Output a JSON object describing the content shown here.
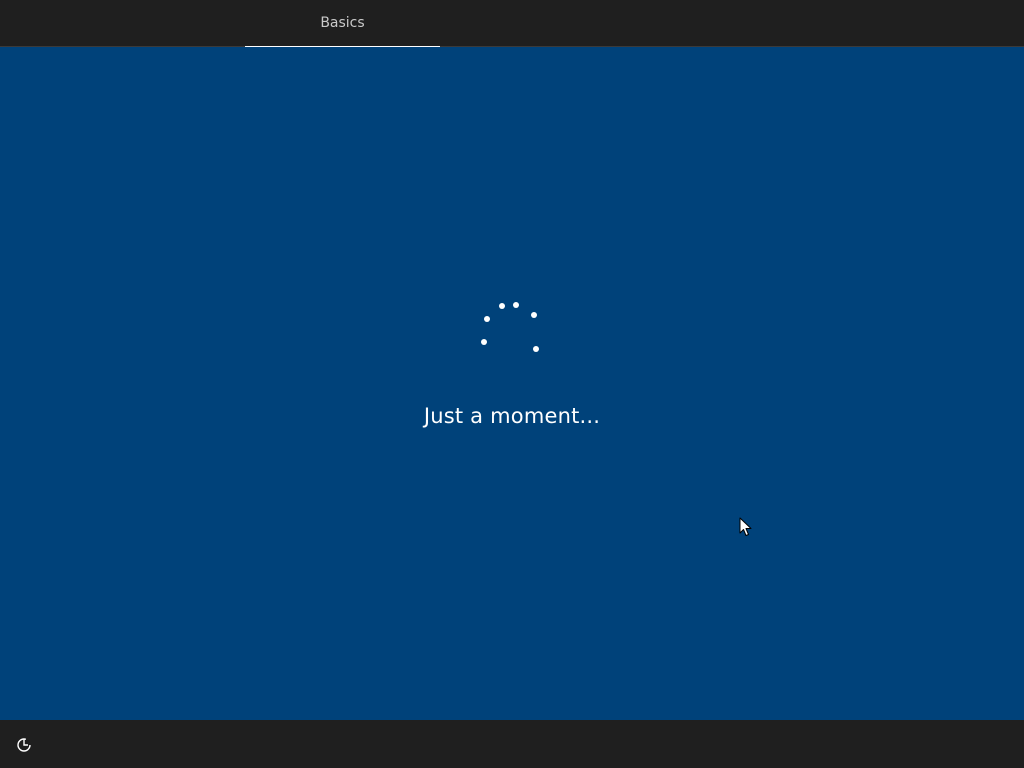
{
  "header": {
    "tabs": [
      {
        "label": "Basics",
        "active": true
      }
    ]
  },
  "main": {
    "message": "Just a moment...",
    "background_color": "#00427a"
  },
  "footer": {
    "ease_of_access_icon": "ease-of-access-icon"
  },
  "colors": {
    "bar_background": "#1f1f1f",
    "accent_underline": "#ffffff",
    "text": "#ffffff"
  }
}
